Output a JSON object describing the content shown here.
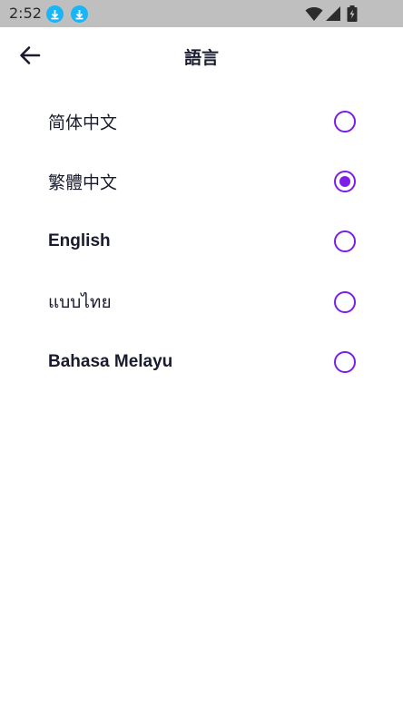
{
  "status_bar": {
    "time": "2:52",
    "icons": [
      "download-icon",
      "download-icon",
      "wifi-icon",
      "signal-icon",
      "battery-charging-icon"
    ]
  },
  "app_bar": {
    "back_icon": "arrow-left-icon",
    "title": "語言"
  },
  "languages": [
    {
      "label": "简体中文",
      "selected": false
    },
    {
      "label": "繁體中文",
      "selected": true
    },
    {
      "label": "English",
      "selected": false
    },
    {
      "label": "แบบไทย",
      "selected": false
    },
    {
      "label": "Bahasa Melayu",
      "selected": false
    }
  ],
  "colors": {
    "accent": "#7a1ee8",
    "status_bar": "#bfbfbf",
    "download_badge": "#19b5f5",
    "text": "#1a1c2e"
  }
}
